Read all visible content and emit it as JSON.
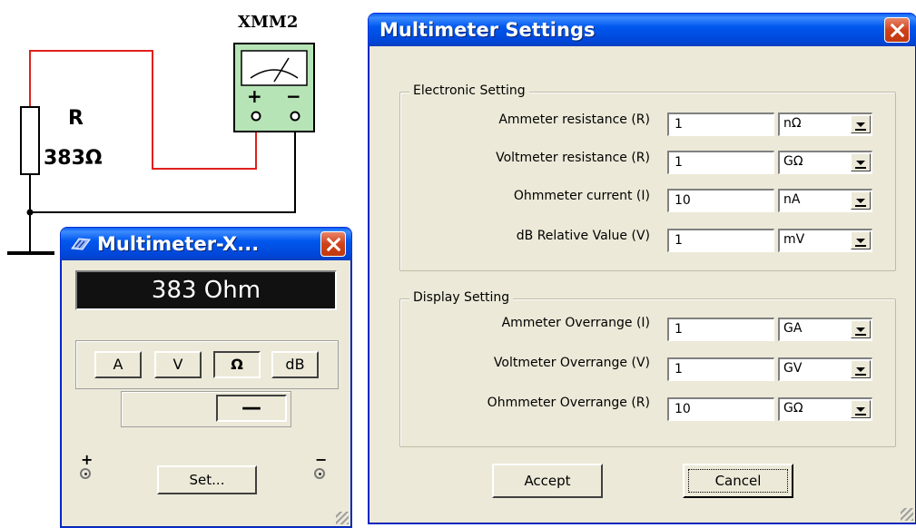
{
  "schematic": {
    "resistor_name": "R",
    "resistor_value": "383Ω",
    "instrument_label": "XMM2",
    "meter_plus": "+",
    "meter_minus": "−"
  },
  "multimeter_window": {
    "title": "Multimeter-X...",
    "display_value": "383 Ohm",
    "modes": [
      {
        "label": "A",
        "active": false
      },
      {
        "label": "V",
        "active": false
      },
      {
        "label": "Ω",
        "active": true
      },
      {
        "label": "dB",
        "active": false
      }
    ],
    "signal": "—",
    "terminal_plus": "+",
    "terminal_minus": "−",
    "set_button": "Set..."
  },
  "settings_dialog": {
    "title": "Multimeter Settings",
    "electronic_group": "Electronic Setting",
    "electronic_rows": [
      {
        "label": "Ammeter resistance (R)",
        "value": "1",
        "unit": "nΩ"
      },
      {
        "label": "Voltmeter resistance (R)",
        "value": "1",
        "unit": "GΩ"
      },
      {
        "label": "Ohmmeter current (I)",
        "value": "10",
        "unit": "nA"
      },
      {
        "label": "dB Relative Value (V)",
        "value": "1",
        "unit": "mV"
      }
    ],
    "display_group": "Display Setting",
    "display_rows": [
      {
        "label": "Ammeter Overrange (I)",
        "value": "1",
        "unit": "GA"
      },
      {
        "label": "Voltmeter Overrange (V)",
        "value": "1",
        "unit": "GV"
      },
      {
        "label": "Ohmmeter Overrange (R)",
        "value": "10",
        "unit": "GΩ"
      }
    ],
    "accept_button": "Accept",
    "cancel_button": "Cancel"
  },
  "colors": {
    "wire_red": "#E0201A",
    "wire_black": "#000000",
    "meter_green": "#B6E4B6",
    "titlebar_blue": "#0055E5",
    "window_bg": "#ECE9D8"
  }
}
